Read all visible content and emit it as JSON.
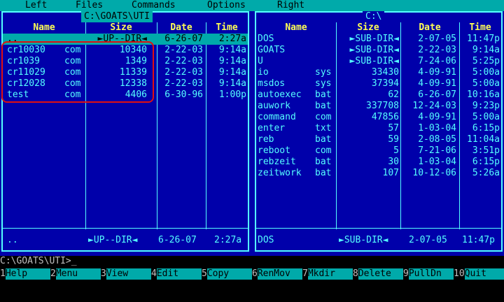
{
  "menu": [
    "Left",
    "Files",
    "Commands",
    "Options",
    "Right"
  ],
  "left_panel": {
    "title": "C:\\GOATS\\UTI",
    "headers": {
      "name": "Name",
      "size": "Size",
      "date": "Date",
      "time": "Time"
    },
    "rows": [
      {
        "name": "..",
        "ext": "",
        "size": "►UP--DIR◄",
        "date": "6-26-07",
        "time": "2:27a",
        "selected": true
      },
      {
        "name": "cr10030",
        "ext": "com",
        "size": "10340",
        "date": "2-22-03",
        "time": "9:14a"
      },
      {
        "name": "cr1039",
        "ext": "com",
        "size": "1349",
        "date": "2-22-03",
        "time": "9:14a"
      },
      {
        "name": "cr11029",
        "ext": "com",
        "size": "11339",
        "date": "2-22-03",
        "time": "9:14a"
      },
      {
        "name": "cr12028",
        "ext": "com",
        "size": "12338",
        "date": "2-22-03",
        "time": "9:14a"
      },
      {
        "name": "test",
        "ext": "com",
        "size": "4406",
        "date": "6-30-96",
        "time": "1:00p"
      }
    ],
    "status": {
      "name": "..",
      "size": "►UP--DIR◄",
      "date": "6-26-07",
      "time": "2:27a"
    }
  },
  "right_panel": {
    "title": "C:\\",
    "headers": {
      "name": "Name",
      "size": "Size",
      "date": "Date",
      "time": "Time"
    },
    "rows": [
      {
        "name": "DOS",
        "ext": "",
        "size": "►SUB-DIR◄",
        "date": "2-07-05",
        "time": "11:47p"
      },
      {
        "name": "GOATS",
        "ext": "",
        "size": "►SUB-DIR◄",
        "date": "2-22-03",
        "time": "9:14a"
      },
      {
        "name": "U",
        "ext": "",
        "size": "►SUB-DIR◄",
        "date": "7-24-06",
        "time": "5:25p"
      },
      {
        "name": "io",
        "ext": "sys",
        "size": "33430",
        "date": "4-09-91",
        "time": "5:00a"
      },
      {
        "name": "msdos",
        "ext": "sys",
        "size": "37394",
        "date": "4-09-91",
        "time": "5:00a"
      },
      {
        "name": "autoexec",
        "ext": "bat",
        "size": "62",
        "date": "6-26-07",
        "time": "10:16a"
      },
      {
        "name": "auwork",
        "ext": "bat",
        "size": "337708",
        "date": "12-24-03",
        "time": "9:23p"
      },
      {
        "name": "command",
        "ext": "com",
        "size": "47856",
        "date": "4-09-91",
        "time": "5:00a"
      },
      {
        "name": "enter",
        "ext": "txt",
        "size": "57",
        "date": "1-03-04",
        "time": "6:15p"
      },
      {
        "name": "reb",
        "ext": "bat",
        "size": "59",
        "date": "2-08-05",
        "time": "11:04a"
      },
      {
        "name": "reboot",
        "ext": "com",
        "size": "5",
        "date": "7-21-06",
        "time": "3:51p"
      },
      {
        "name": "rebzeit",
        "ext": "bat",
        "size": "30",
        "date": "1-03-04",
        "time": "6:15p"
      },
      {
        "name": "zeitwork",
        "ext": "bat",
        "size": "107",
        "date": "10-12-06",
        "time": "5:26a"
      }
    ],
    "status": {
      "name": "DOS",
      "size": "►SUB-DIR◄",
      "date": "2-07-05",
      "time": "11:47p"
    }
  },
  "command_line": "C:\\GOATS\\UTI>_",
  "function_keys": [
    {
      "num": "1",
      "label": "Help"
    },
    {
      "num": "2",
      "label": "Menu"
    },
    {
      "num": "3",
      "label": "View"
    },
    {
      "num": "4",
      "label": "Edit"
    },
    {
      "num": "5",
      "label": "Copy"
    },
    {
      "num": "6",
      "label": "RenMov"
    },
    {
      "num": "7",
      "label": "Mkdir"
    },
    {
      "num": "8",
      "label": "Delete"
    },
    {
      "num": "9",
      "label": "PullDn"
    },
    {
      "num": "10",
      "label": "Quit"
    }
  ],
  "colors": {
    "panel_bg": "#0000aa",
    "panel_fg": "#55ffff",
    "header_fg": "#ffff55",
    "cursor_bg": "#00aaaa",
    "annotation": "#e01010"
  }
}
